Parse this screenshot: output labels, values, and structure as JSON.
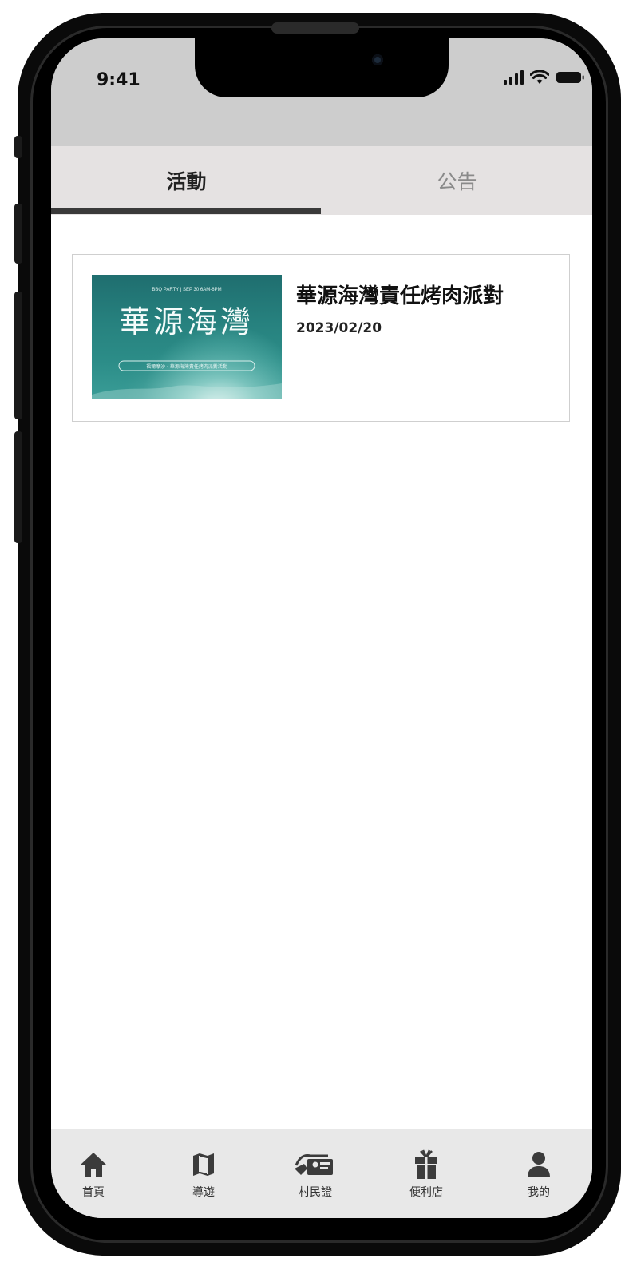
{
  "status_bar": {
    "time": "9:41"
  },
  "tabs": [
    {
      "label": "活動",
      "active": true
    },
    {
      "label": "公告",
      "active": false
    }
  ],
  "activities": [
    {
      "title": "華源海灣責任烤肉派對",
      "date": "2023/02/20",
      "thumbnail": {
        "top_text": "BBQ PARTY | SEP 30 6AM-6PM",
        "headline": "華源海灣",
        "sub_text": "福爾摩沙 · 華源海灣責任烤肉派對活動"
      }
    }
  ],
  "bottom_nav": [
    {
      "label": "首頁",
      "icon": "home-icon"
    },
    {
      "label": "導遊",
      "icon": "map-icon"
    },
    {
      "label": "村民證",
      "icon": "id-card-icon"
    },
    {
      "label": "便利店",
      "icon": "gift-icon"
    },
    {
      "label": "我的",
      "icon": "user-icon"
    }
  ],
  "colors": {
    "status_bar_bg": "#cdcdcd",
    "tab_bar_bg": "#e5e2e2",
    "tab_indicator": "#3a3a3a",
    "nav_icon": "#3b3b3b",
    "thumbnail_teal": "#27827f"
  }
}
